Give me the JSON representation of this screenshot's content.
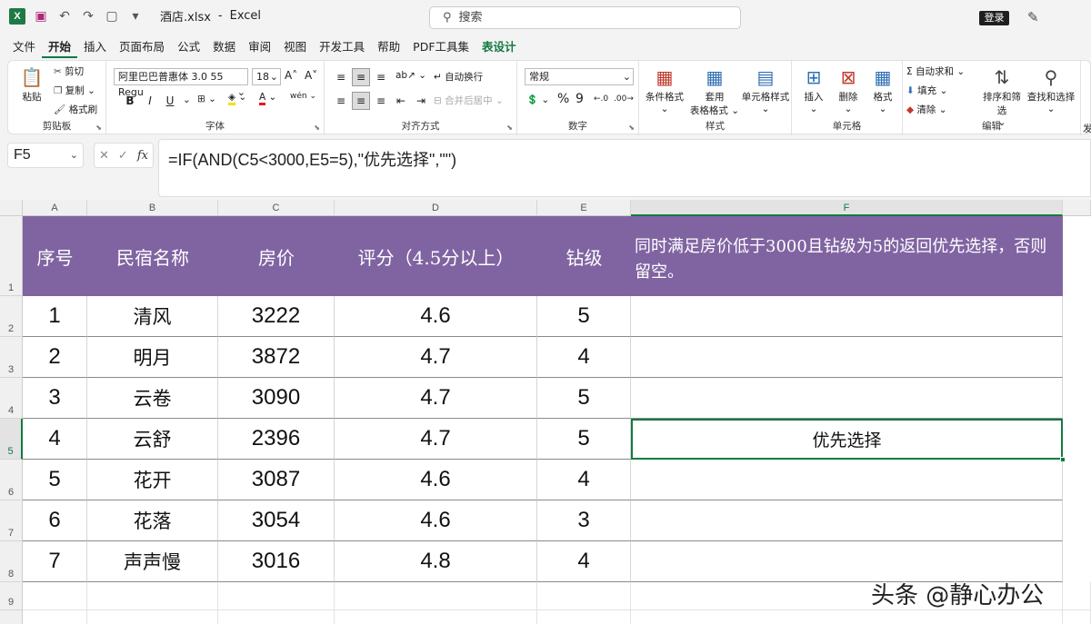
{
  "titlebar": {
    "filename": "酒店.xlsx",
    "separator": "-",
    "app": "Excel",
    "search_placeholder": "搜索",
    "login": "登录"
  },
  "menu": [
    "文件",
    "开始",
    "插入",
    "页面布局",
    "公式",
    "数据",
    "审阅",
    "视图",
    "开发工具",
    "帮助",
    "PDF工具集",
    "表设计"
  ],
  "ribbon": {
    "clipboard": {
      "label": "剪贴板",
      "paste": "粘贴",
      "cut": "剪切",
      "copy": "复制",
      "format_painter": "格式刷"
    },
    "font": {
      "label": "字体",
      "font_name": "阿里巴巴普惠体 3.0 55 Regu",
      "font_size": "18",
      "bold": "B",
      "italic": "I",
      "underline": "U"
    },
    "alignment": {
      "label": "对齐方式",
      "wrap": "自动换行",
      "merge": "合并后居中"
    },
    "number": {
      "label": "数字",
      "format": "常规",
      "percent": "%",
      "comma": "9"
    },
    "styles": {
      "label": "样式",
      "conditional": "条件格式",
      "table_format_1": "套用",
      "table_format_2": "表格格式",
      "cell_styles": "单元格样式"
    },
    "cells": {
      "label": "单元格",
      "insert": "插入",
      "delete": "删除",
      "format": "格式"
    },
    "editing": {
      "label": "编辑",
      "autosum": "自动求和",
      "fill": "填充",
      "clear": "清除",
      "sort_filter": "排序和筛选",
      "find_select": "查找和选择"
    },
    "cut_off_label": "发"
  },
  "formula_bar": {
    "name_box": "F5",
    "fx": "fx",
    "formula": "=IF(AND(C5<3000,E5=5),\"优先选择\",\"\")"
  },
  "columns": [
    "A",
    "B",
    "C",
    "D",
    "E",
    "F"
  ],
  "rows": [
    "1",
    "2",
    "3",
    "4",
    "5",
    "6",
    "7",
    "8",
    "9"
  ],
  "table": {
    "headers": [
      "序号",
      "民宿名称",
      "房价",
      "评分（4.5分以上）",
      "钻级",
      "同时满足房价低于3000且钻级为5的返回优先选择，否则留空。"
    ],
    "rows": [
      [
        "1",
        "清风",
        "3222",
        "4.6",
        "5",
        ""
      ],
      [
        "2",
        "明月",
        "3872",
        "4.7",
        "4",
        ""
      ],
      [
        "3",
        "云卷",
        "3090",
        "4.7",
        "5",
        ""
      ],
      [
        "4",
        "云舒",
        "2396",
        "4.7",
        "5",
        "优先选择"
      ],
      [
        "5",
        "花开",
        "3087",
        "4.6",
        "4",
        ""
      ],
      [
        "6",
        "花落",
        "3054",
        "4.6",
        "3",
        ""
      ],
      [
        "7",
        "声声慢",
        "3016",
        "4.8",
        "4",
        ""
      ]
    ]
  },
  "watermark": "头条 @静心办公",
  "colors": {
    "header_bg": "#8064a2",
    "accent": "#117a41"
  }
}
